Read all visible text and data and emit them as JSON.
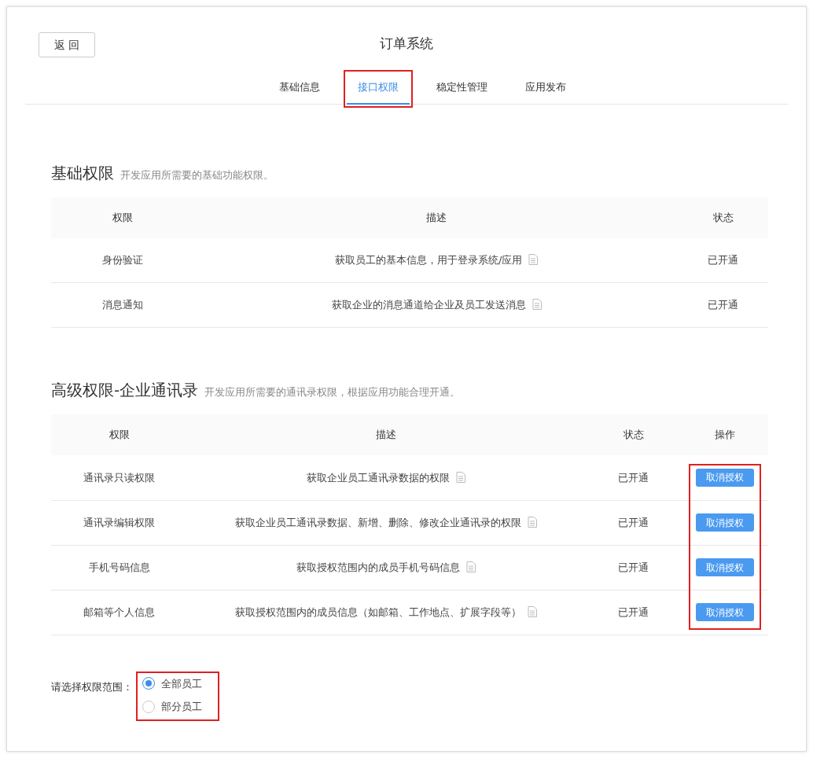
{
  "back_button": "返 回",
  "title": "订单系统",
  "tabs": [
    {
      "label": "基础信息",
      "selected": false
    },
    {
      "label": "接口权限",
      "selected": true,
      "highlighted": true
    },
    {
      "label": "稳定性管理",
      "selected": false
    },
    {
      "label": "应用发布",
      "selected": false
    }
  ],
  "sections": [
    {
      "title": "基础权限",
      "subtitle": "开发应用所需要的基础功能权限。",
      "columns": [
        "权限",
        "描述",
        "状态"
      ],
      "rows": [
        {
          "name": "身份验证",
          "description": "获取员工的基本信息，用于登录系统/应用",
          "status": "已开通"
        },
        {
          "name": "消息通知",
          "description": "获取企业的消息通道给企业及员工发送消息",
          "status": "已开通"
        }
      ]
    },
    {
      "title": "高级权限-企业通讯录",
      "subtitle": "开发应用所需要的通讯录权限，根据应用功能合理开通。",
      "columns": [
        "权限",
        "描述",
        "状态",
        "操作"
      ],
      "action_highlighted": true,
      "rows": [
        {
          "name": "通讯录只读权限",
          "description": "获取企业员工通讯录数据的权限",
          "status": "已开通",
          "action": "取消授权"
        },
        {
          "name": "通讯录编辑权限",
          "description": "获取企业员工通讯录数据、新增、删除、修改企业通讯录的权限",
          "status": "已开通",
          "action": "取消授权"
        },
        {
          "name": "手机号码信息",
          "description": "获取授权范围内的成员手机号码信息",
          "status": "已开通",
          "action": "取消授权"
        },
        {
          "name": "邮箱等个人信息",
          "description": "获取授权范围内的成员信息（如邮箱、工作地点、扩展字段等）",
          "status": "已开通",
          "action": "取消授权"
        }
      ]
    }
  ],
  "scope": {
    "label": "请选择权限范围：",
    "highlighted": true,
    "options": [
      {
        "label": "全部员工",
        "selected": true
      },
      {
        "label": "部分员工",
        "selected": false
      }
    ]
  }
}
